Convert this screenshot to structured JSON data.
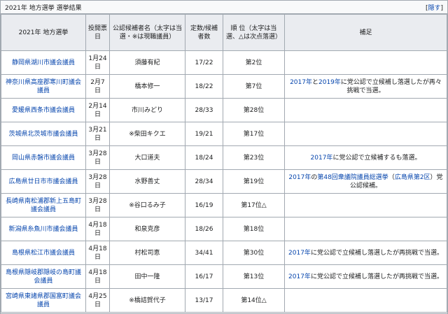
{
  "title": "2021年 地方選挙 選挙結果",
  "toggle": {
    "open": "[",
    "label": "隠す",
    "close": "]"
  },
  "headers": [
    "2021年 地方選挙",
    "投開票日",
    "公認候補者名（太字は当選・※は現職議員）",
    "定数/候補者数",
    "順 位（太字は当選、△は次点落選）",
    "補足"
  ],
  "rows": [
    {
      "election": "静岡県湖川市議会議員",
      "date": "1月24日",
      "candidate": "須藤有紀",
      "seats": "17/22",
      "rank": "第2位",
      "note": []
    },
    {
      "election": "神奈川県高座郡寒川町議会議員",
      "date": "2月7日",
      "candidate": "橋本修一",
      "seats": "18/22",
      "rank": "第7位",
      "note": [
        {
          "t": "2017年",
          "l": true
        },
        {
          "t": "と",
          "l": false
        },
        {
          "t": "2019年",
          "l": true
        },
        {
          "t": "に党公認で立候補し落選したが再々挑戦で当選。",
          "l": false
        }
      ]
    },
    {
      "election": "愛媛県西条市議会議員",
      "date": "2月14日",
      "candidate": "市川みどり",
      "seats": "28/33",
      "rank": "第28位",
      "note": []
    },
    {
      "election": "茨城県北茨城市議会議員",
      "date": "3月21日",
      "candidate": "※柴田キクエ",
      "seats": "19/21",
      "rank": "第17位",
      "note": []
    },
    {
      "election": "岡山県赤磐市議会議員",
      "date": "3月28日",
      "candidate": "大口道夫",
      "seats": "18/24",
      "rank": "第23位",
      "note": [
        {
          "t": "2017年",
          "l": true
        },
        {
          "t": "に党公認で立候補するも落選。",
          "l": false
        }
      ]
    },
    {
      "election": "広島県廿日市市議会議員",
      "date": "3月28日",
      "candidate": "水野善丈",
      "seats": "28/34",
      "rank": "第19位",
      "note": [
        {
          "t": "2017年",
          "l": true
        },
        {
          "t": "の",
          "l": false
        },
        {
          "t": "第48回衆議院議員総選挙",
          "l": true
        },
        {
          "t": "（",
          "l": false
        },
        {
          "t": "広島県第2区",
          "l": true
        },
        {
          "t": "）党公認候補。",
          "l": false
        }
      ]
    },
    {
      "election": "長崎県南松浦郡新上五島町議会議員",
      "date": "3月28日",
      "candidate": "※谷口るみ子",
      "seats": "16/19",
      "rank": "第17位△",
      "note": []
    },
    {
      "election": "新潟県糸魚川市議会議員",
      "date": "4月18日",
      "candidate": "和泉克彦",
      "seats": "18/26",
      "rank": "第18位",
      "note": []
    },
    {
      "election": "島根県松江市議会議員",
      "date": "4月18日",
      "candidate": "村松司恵",
      "seats": "34/41",
      "rank": "第30位",
      "note": [
        {
          "t": "2017年",
          "l": true
        },
        {
          "t": "に党公認で立候補し落選したが再挑戦で当選。",
          "l": false
        }
      ]
    },
    {
      "election": "島根県隠岐郡隠岐の島町議会議員",
      "date": "4月18日",
      "candidate": "田中一隆",
      "seats": "16/17",
      "rank": "第13位",
      "note": [
        {
          "t": "2017年",
          "l": true
        },
        {
          "t": "に党公認で立候補し落選したが再挑戦で当選。",
          "l": false
        }
      ]
    },
    {
      "election": "宮崎県東諸県郡国富町議会議員",
      "date": "4月25日",
      "candidate": "※橋詰賀代子",
      "seats": "13/17",
      "rank": "第14位△",
      "note": []
    }
  ]
}
